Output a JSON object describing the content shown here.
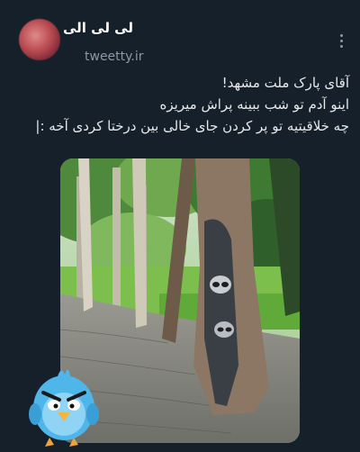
{
  "tweet": {
    "author_name": "لی لی الی",
    "author_handle": "tweetty.ir",
    "text_lines": [
      "آقای پارک ملت مشهد!",
      "اینو آدم تو شب ببینه پراش میریزه",
      "چه خلاقیتیه تو پر کردن جای خالی بین درختا کردی آخه :|"
    ]
  },
  "icons": {
    "more_menu": "more-vertical-icon",
    "sticker": "angry-bird-sticker"
  },
  "colors": {
    "background": "#15202b",
    "text_primary": "#e7e9ea",
    "text_secondary": "#8b98a5"
  }
}
